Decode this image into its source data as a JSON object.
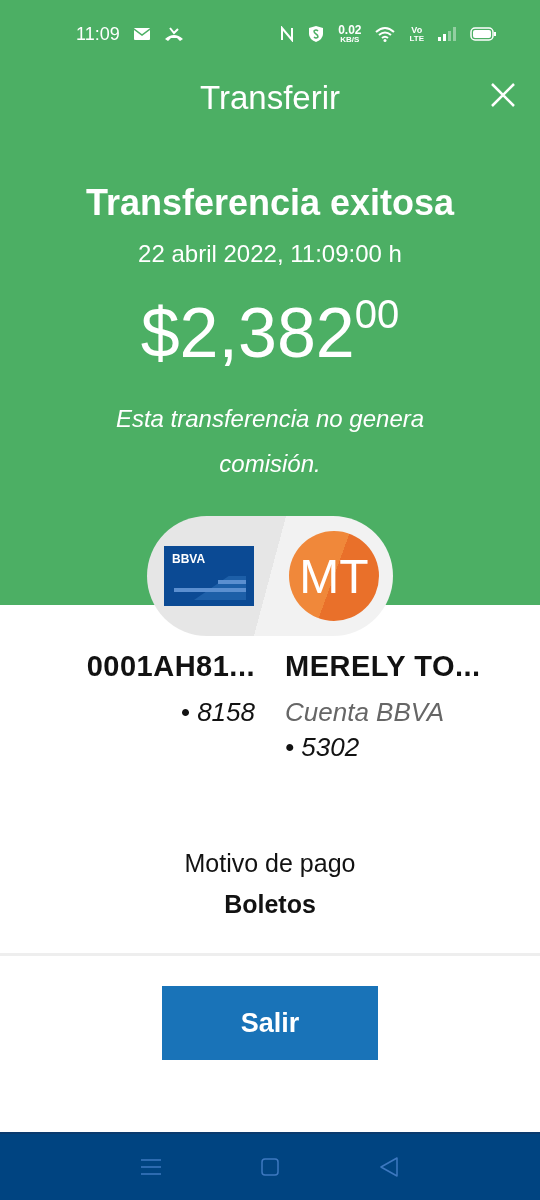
{
  "status_bar": {
    "time": "11:09",
    "speed_value": "0.02",
    "speed_unit": "KB/S",
    "volte_top": "Vo",
    "volte_bottom": "LTE"
  },
  "header": {
    "title": "Transferir"
  },
  "result": {
    "heading": "Transferencia exitosa",
    "date": "22 abril 2022, 11:09:00 h",
    "amount": "$2,382$^{00}$",
    "note": "Esta transferencia no genera comisión."
  },
  "origin": {
    "card_brand": "BBVA",
    "name": "0001AH81...",
    "account": "• 8158"
  },
  "destination": {
    "initials": "MT",
    "name": "MERELY TO...",
    "bank": "Cuenta BBVA",
    "account": "• 5302"
  },
  "reason": {
    "label": "Motivo de pago",
    "value": "Boletos"
  },
  "buttons": [
    {
      "label": "Salir"
    }
  ]
}
